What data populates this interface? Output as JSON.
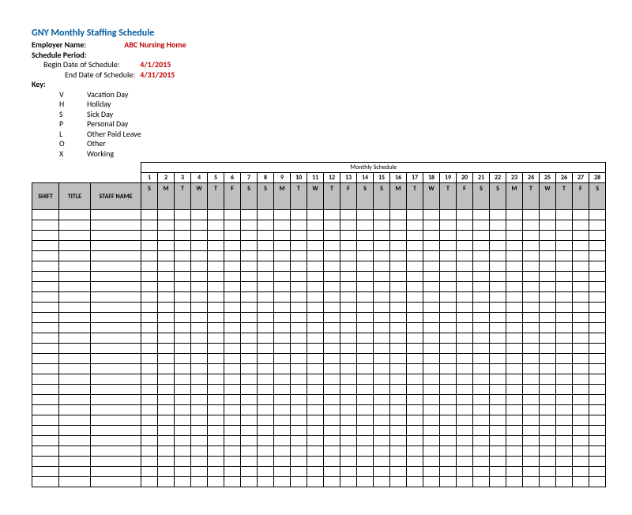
{
  "title": "GNY Monthly Staffing Schedule",
  "employer_label": "Employer Name:",
  "employer_value": "ABC Nursing Home",
  "period_label": "Schedule Period:",
  "begin_label": "Begin Date of Schedule:",
  "begin_value": "4/1/2015",
  "end_label": "End Date of Schedule:",
  "end_value": "4/31/2015",
  "key_label": "Key:",
  "key": [
    {
      "code": "V",
      "desc": "Vacation Day"
    },
    {
      "code": "H",
      "desc": "Holiday"
    },
    {
      "code": "S",
      "desc": "Sick Day"
    },
    {
      "code": "P",
      "desc": "Personal Day"
    },
    {
      "code": "L",
      "desc": "Other Paid Leave"
    },
    {
      "code": "O",
      "desc": "Other"
    },
    {
      "code": "X",
      "desc": "Working"
    }
  ],
  "monthly_title": "Monthly Schedule",
  "col_shift": "SHIFT",
  "col_title": "TITLE",
  "col_name": "STAFF NAME",
  "days": [
    {
      "n": "1",
      "d": "S"
    },
    {
      "n": "2",
      "d": "M"
    },
    {
      "n": "3",
      "d": "T"
    },
    {
      "n": "4",
      "d": "W"
    },
    {
      "n": "5",
      "d": "T"
    },
    {
      "n": "6",
      "d": "F"
    },
    {
      "n": "7",
      "d": "S"
    },
    {
      "n": "8",
      "d": "S"
    },
    {
      "n": "9",
      "d": "M"
    },
    {
      "n": "10",
      "d": "T"
    },
    {
      "n": "11",
      "d": "W"
    },
    {
      "n": "12",
      "d": "T"
    },
    {
      "n": "13",
      "d": "F"
    },
    {
      "n": "14",
      "d": "S"
    },
    {
      "n": "15",
      "d": "S"
    },
    {
      "n": "16",
      "d": "M"
    },
    {
      "n": "17",
      "d": "T"
    },
    {
      "n": "18",
      "d": "W"
    },
    {
      "n": "19",
      "d": "T"
    },
    {
      "n": "20",
      "d": "F"
    },
    {
      "n": "21",
      "d": "S"
    },
    {
      "n": "22",
      "d": "S"
    },
    {
      "n": "23",
      "d": "M"
    },
    {
      "n": "24",
      "d": "T"
    },
    {
      "n": "25",
      "d": "W"
    },
    {
      "n": "26",
      "d": "T"
    },
    {
      "n": "27",
      "d": "F"
    },
    {
      "n": "28",
      "d": "S"
    }
  ],
  "blank_rows": 27
}
